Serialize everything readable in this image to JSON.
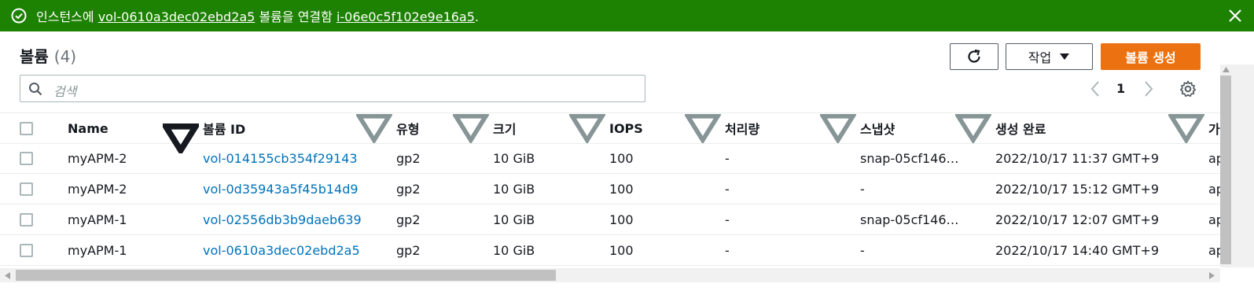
{
  "flash": {
    "prefix": "인스턴스에",
    "volume_link": "vol-0610a3dec02ebd2a5",
    "middle": "볼륨을 연결함",
    "instance_link": "i-06e0c5f102e9e16a5",
    "suffix": ".",
    "color": "#1d8102"
  },
  "header": {
    "title": "볼륨",
    "count": "(4)",
    "actions_label": "작업",
    "create_label": "볼륨 생성",
    "create_color": "#ec7211"
  },
  "search": {
    "placeholder": "검색"
  },
  "pagination": {
    "page": "1"
  },
  "table": {
    "columns": [
      "Name",
      "볼륨 ID",
      "유형",
      "크기",
      "IOPS",
      "처리량",
      "스냅샷",
      "생성 완료",
      "가"
    ],
    "rows": [
      {
        "name": "myAPM-2",
        "volume_id": "vol-014155cb354f29143",
        "type": "gp2",
        "size": "10 GiB",
        "iops": "100",
        "throughput": "-",
        "snapshot": "snap-05cf146…",
        "created": "2022/10/17 11:37 GMT+9",
        "extra": "ap"
      },
      {
        "name": "myAPM-2",
        "volume_id": "vol-0d35943a5f45b14d9",
        "type": "gp2",
        "size": "10 GiB",
        "iops": "100",
        "throughput": "-",
        "snapshot": "-",
        "created": "2022/10/17 15:12 GMT+9",
        "extra": "ap"
      },
      {
        "name": "myAPM-1",
        "volume_id": "vol-02556db3b9daeb639",
        "type": "gp2",
        "size": "10 GiB",
        "iops": "100",
        "throughput": "-",
        "snapshot": "snap-05cf146…",
        "created": "2022/10/17 12:07 GMT+9",
        "extra": "ap"
      },
      {
        "name": "myAPM-1",
        "volume_id": "vol-0610a3dec02ebd2a5",
        "type": "gp2",
        "size": "10 GiB",
        "iops": "100",
        "throughput": "-",
        "snapshot": "-",
        "created": "2022/10/17 14:40 GMT+9",
        "extra": "ap"
      }
    ]
  },
  "icons": {
    "success": "check-circle-icon",
    "close": "close-icon",
    "refresh": "refresh-icon",
    "caret": "caret-down-icon",
    "search": "search-icon",
    "prev": "chevron-left-icon",
    "next": "chevron-right-icon",
    "settings": "gear-icon"
  }
}
